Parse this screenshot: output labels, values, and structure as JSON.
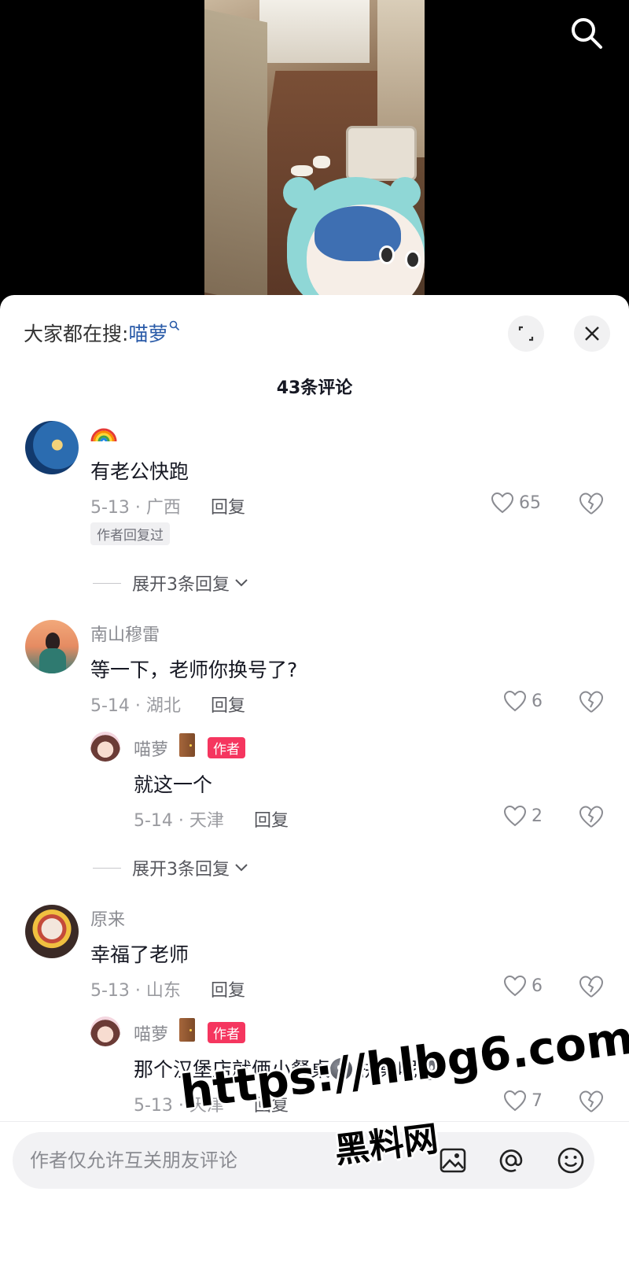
{
  "search_suggest": {
    "prefix": "大家都在搜:",
    "keyword": "喵萝"
  },
  "comment_count": "43条评论",
  "comments": [
    {
      "nickname": "",
      "text": "有老公快跑",
      "date_loc": "5-13 · 广西",
      "reply_label": "回复",
      "likes": "65",
      "tag": "作者回复过",
      "expand_label": "展开3条回复"
    },
    {
      "nickname": "南山穆雷",
      "text": "等一下，老师你换号了?",
      "date_loc": "5-14 · 湖北",
      "reply_label": "回复",
      "likes": "6",
      "author_reply": {
        "nickname": "喵萝",
        "badge": "作者",
        "text": "就这一个",
        "date_loc": "5-14 · 天津",
        "reply_label": "回复",
        "likes": "2"
      },
      "expand_label": "展开3条回复"
    },
    {
      "nickname": "原来",
      "text": "幸福了老师",
      "date_loc": "5-13 · 山东",
      "reply_label": "回复",
      "likes": "6",
      "author_reply": {
        "nickname": "喵萝",
        "badge": "作者",
        "text_part1": "那个汉堡店就俩小餐桌",
        "text_part2": " 拼桌呢",
        "date_loc": "5-13 · 天津",
        "reply_label": "回复",
        "likes": "7"
      }
    }
  ],
  "input": {
    "placeholder": "作者仅允许互关朋友评论"
  },
  "watermark": {
    "line1": "https://hlbg6.com",
    "line2": "黑料网"
  },
  "colors": {
    "accent_link": "#2a5ba8",
    "author_badge": "#f5365f"
  }
}
